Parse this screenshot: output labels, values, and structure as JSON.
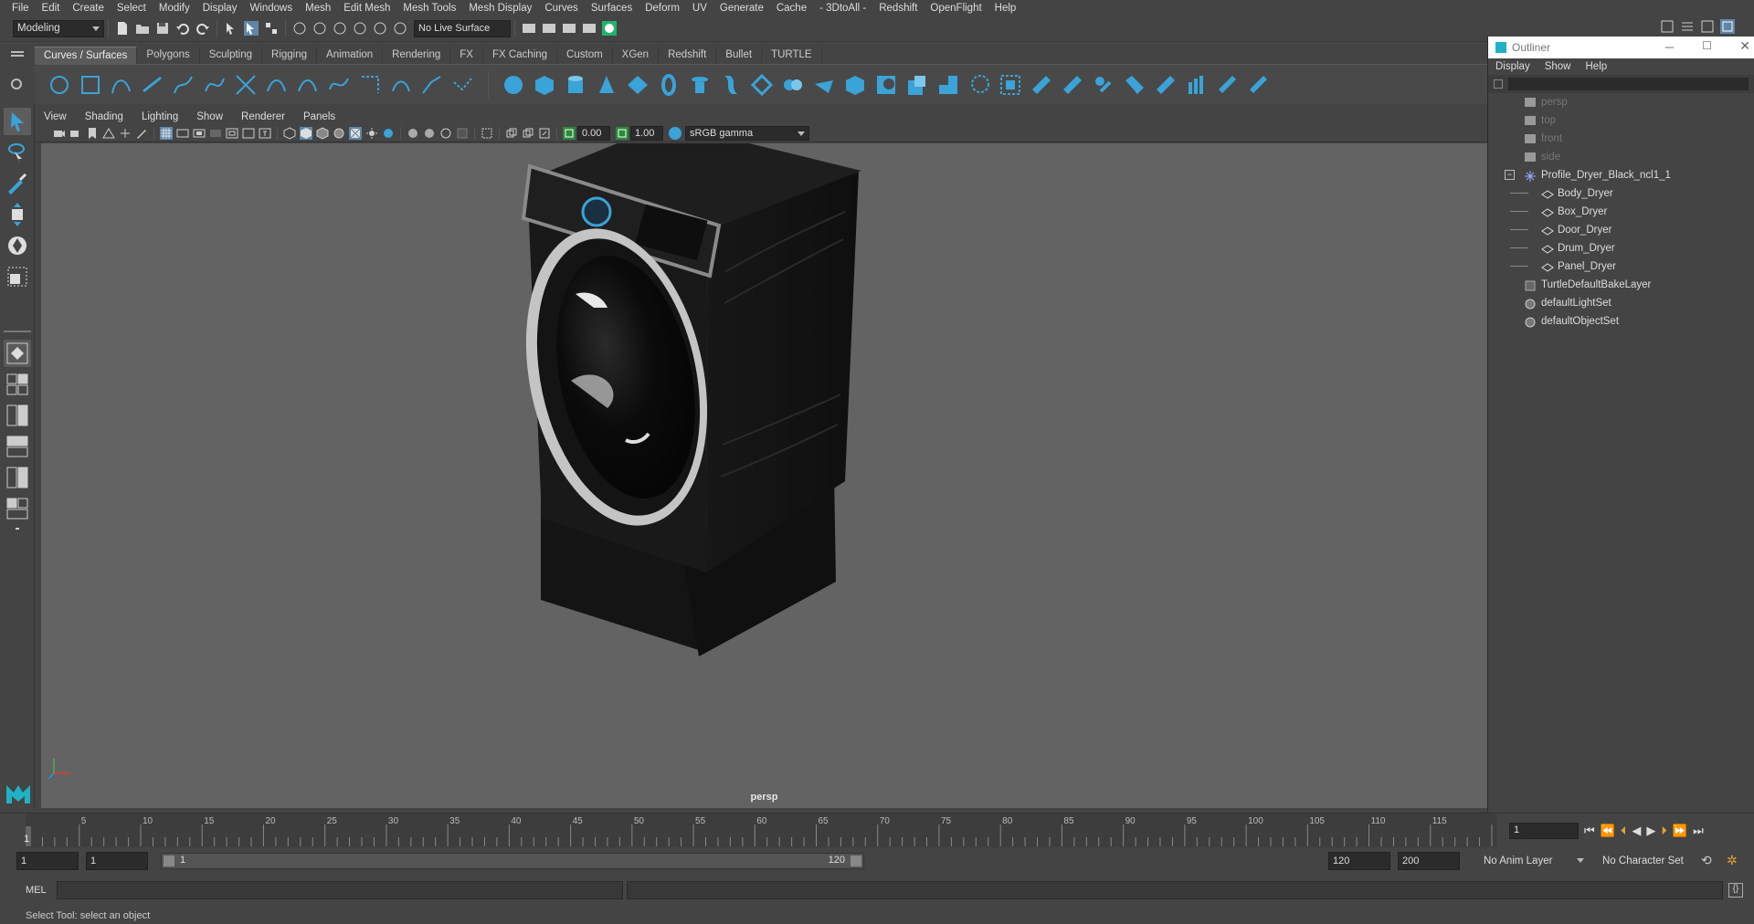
{
  "menubar": [
    "File",
    "Edit",
    "Create",
    "Select",
    "Modify",
    "Display",
    "Windows",
    "Mesh",
    "Edit Mesh",
    "Mesh Tools",
    "Mesh Display",
    "Curves",
    "Surfaces",
    "Deform",
    "UV",
    "Generate",
    "Cache",
    "- 3DtoAll -",
    "Redshift",
    "OpenFlight",
    "Help"
  ],
  "status": {
    "mode": "Modeling",
    "live_surface": "No Live Surface"
  },
  "shelf_tabs": [
    "Curves / Surfaces",
    "Polygons",
    "Sculpting",
    "Rigging",
    "Animation",
    "Rendering",
    "FX",
    "FX Caching",
    "Custom",
    "XGen",
    "Redshift",
    "Bullet",
    "TURTLE"
  ],
  "panel_menu": [
    "View",
    "Shading",
    "Lighting",
    "Show",
    "Renderer",
    "Panels"
  ],
  "panel_toolbar": {
    "exposure": "0.00",
    "gamma": "1.00",
    "colorspace": "sRGB gamma"
  },
  "viewport": {
    "camera": "persp"
  },
  "dryer": {
    "display": "55"
  },
  "outliner": {
    "title": "Outliner",
    "menu": [
      "Display",
      "Show",
      "Help"
    ],
    "items": [
      {
        "label": "persp",
        "type": "camera",
        "indent": 0,
        "dim": true
      },
      {
        "label": "top",
        "type": "camera",
        "indent": 0,
        "dim": true
      },
      {
        "label": "front",
        "type": "camera",
        "indent": 0,
        "dim": true
      },
      {
        "label": "side",
        "type": "camera",
        "indent": 0,
        "dim": true
      },
      {
        "label": "Profile_Dryer_Black_ncl1_1",
        "type": "group",
        "indent": 0,
        "dim": false
      },
      {
        "label": "Body_Dryer",
        "type": "mesh",
        "indent": 1,
        "dim": false
      },
      {
        "label": "Box_Dryer",
        "type": "mesh",
        "indent": 1,
        "dim": false
      },
      {
        "label": "Door_Dryer",
        "type": "mesh",
        "indent": 1,
        "dim": false
      },
      {
        "label": "Drum_Dryer",
        "type": "mesh",
        "indent": 1,
        "dim": false
      },
      {
        "label": "Panel_Dryer",
        "type": "mesh",
        "indent": 1,
        "dim": false
      },
      {
        "label": "TurtleDefaultBakeLayer",
        "type": "layer",
        "indent": 0,
        "dim": false
      },
      {
        "label": "defaultLightSet",
        "type": "set",
        "indent": 0,
        "dim": false
      },
      {
        "label": "defaultObjectSet",
        "type": "set",
        "indent": 0,
        "dim": false
      }
    ]
  },
  "timeline": {
    "ticks": [
      "5",
      "10",
      "15",
      "20",
      "25",
      "30",
      "35",
      "40",
      "45",
      "50",
      "55",
      "60",
      "65",
      "70",
      "75",
      "80",
      "85",
      "90",
      "95",
      "100",
      "105",
      "110",
      "115"
    ],
    "current_frame": "1",
    "frame_field": "1"
  },
  "range": {
    "start": "1",
    "anim_start": "1",
    "slider_start": "1",
    "slider_end": "120",
    "end": "120",
    "anim_end": "200",
    "anim_layer": "No Anim Layer",
    "char_set": "No Character Set"
  },
  "mel": {
    "label": "MEL"
  },
  "help": {
    "text": "Select Tool: select an object"
  },
  "colors": {
    "accent": "#3aa3d8",
    "bg": "#444444",
    "viewport": "#636363"
  }
}
